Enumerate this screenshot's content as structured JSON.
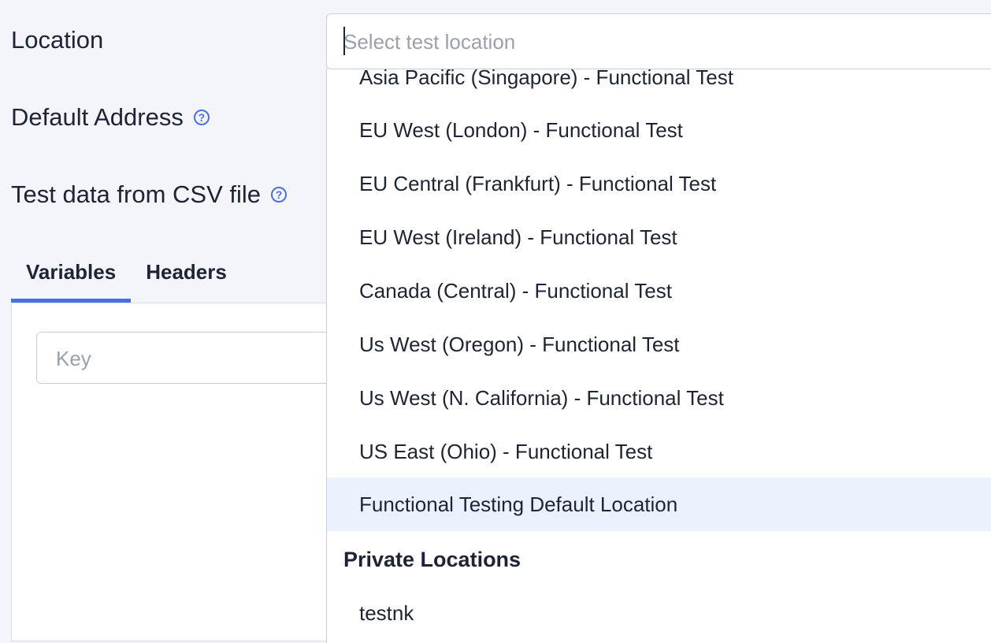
{
  "form": {
    "location_label": "Location",
    "default_address_label": "Default Address",
    "csv_label": "Test data from CSV file",
    "help_glyph": "?"
  },
  "tabs": [
    {
      "label": "Variables",
      "active": true
    },
    {
      "label": "Headers",
      "active": false
    }
  ],
  "variables": {
    "key_placeholder": "Key"
  },
  "location_select": {
    "placeholder": "Select test location",
    "options": [
      "Asia Pacific (Singapore) - Functional Test",
      "EU West (London) - Functional Test",
      "EU Central (Frankfurt) - Functional Test",
      "EU West (Ireland) - Functional Test",
      "Canada (Central) - Functional Test",
      "Us West (Oregon) - Functional Test",
      "Us West (N. California) - Functional Test",
      "US East (Ohio) - Functional Test",
      "Functional Testing Default Location"
    ],
    "highlighted_option": "Functional Testing Default Location",
    "private_group_label": "Private Locations",
    "private_options": [
      "testnk"
    ]
  },
  "colors": {
    "accent": "#4b6ee8",
    "highlight": "#ebf1fd",
    "text": "#1e2433",
    "placeholder": "#9aa0ac"
  }
}
